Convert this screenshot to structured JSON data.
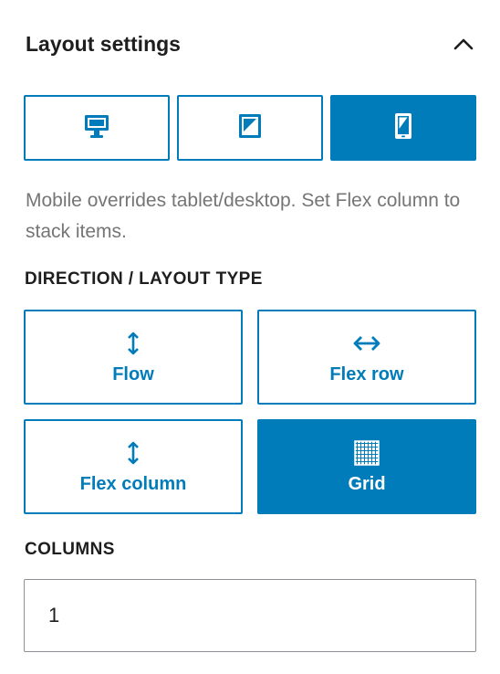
{
  "panel": {
    "title": "Layout settings",
    "toggle_icon": "chevron-up-icon"
  },
  "devices": [
    {
      "name": "desktop",
      "icon": "desktop-icon",
      "active": false
    },
    {
      "name": "tablet",
      "icon": "tablet-icon",
      "active": false
    },
    {
      "name": "mobile",
      "icon": "mobile-icon",
      "active": true
    }
  ],
  "help_text": "Mobile overrides tablet/desktop. Set Flex column to stack items.",
  "direction": {
    "label": "DIRECTION / LAYOUT TYPE",
    "options": [
      {
        "label": "Flow",
        "icon": "arrow-up-down-icon",
        "active": false
      },
      {
        "label": "Flex row",
        "icon": "arrow-left-right-icon",
        "active": false
      },
      {
        "label": "Flex column",
        "icon": "arrow-up-down-icon",
        "active": false
      },
      {
        "label": "Grid",
        "icon": "grid-icon",
        "active": true
      }
    ]
  },
  "columns": {
    "label": "COLUMNS",
    "value": "1"
  },
  "colors": {
    "accent": "#007cba",
    "help_text": "#757575",
    "text": "#1e1e1e"
  }
}
